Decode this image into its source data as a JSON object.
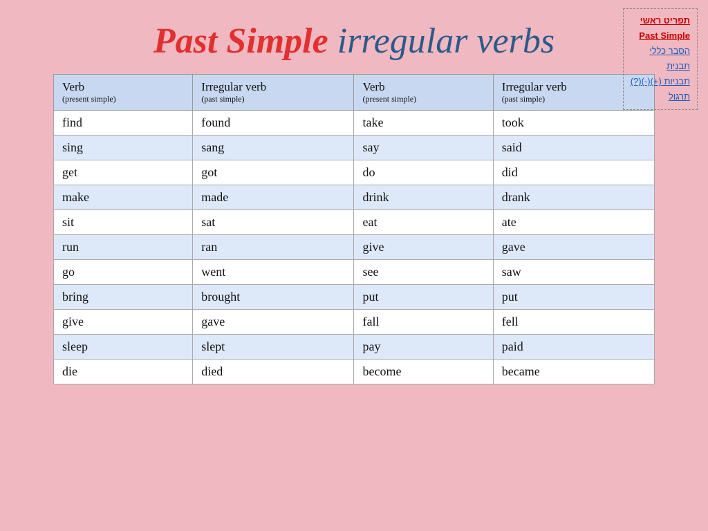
{
  "page": {
    "background_color": "#f0b8c0"
  },
  "title": {
    "part1": "Past Simple",
    "part2": " irregular verbs"
  },
  "nav": {
    "items": [
      {
        "label": "תפריט ראשי",
        "active": true
      },
      {
        "label": "Past Simple",
        "active": true
      },
      {
        "label": "הסבר כללי",
        "active": false
      },
      {
        "label": "תבנית",
        "active": false
      },
      {
        "label": "תבניות (+)(-)(?)‎",
        "active": false
      },
      {
        "label": "תרגול",
        "active": false
      }
    ]
  },
  "table": {
    "headers": [
      {
        "main": "Verb",
        "sub": "(present simple)"
      },
      {
        "main": "Irregular verb",
        "sub": "(past simple)"
      },
      {
        "main": "Verb",
        "sub": "(present simple)"
      },
      {
        "main": "Irregular verb",
        "sub": "(past simple)"
      }
    ],
    "rows": [
      [
        "find",
        "found",
        "take",
        "took"
      ],
      [
        "sing",
        "sang",
        "say",
        "said"
      ],
      [
        "get",
        "got",
        "do",
        "did"
      ],
      [
        "make",
        "made",
        "drink",
        "drank"
      ],
      [
        "sit",
        "sat",
        "eat",
        "ate"
      ],
      [
        "run",
        "ran",
        "give",
        "gave"
      ],
      [
        "go",
        "went",
        "see",
        "saw"
      ],
      [
        "bring",
        "brought",
        "put",
        "put"
      ],
      [
        "give",
        "gave",
        "fall",
        "fell"
      ],
      [
        "sleep",
        "slept",
        "pay",
        "paid"
      ],
      [
        "die",
        "died",
        "become",
        "became"
      ]
    ]
  }
}
